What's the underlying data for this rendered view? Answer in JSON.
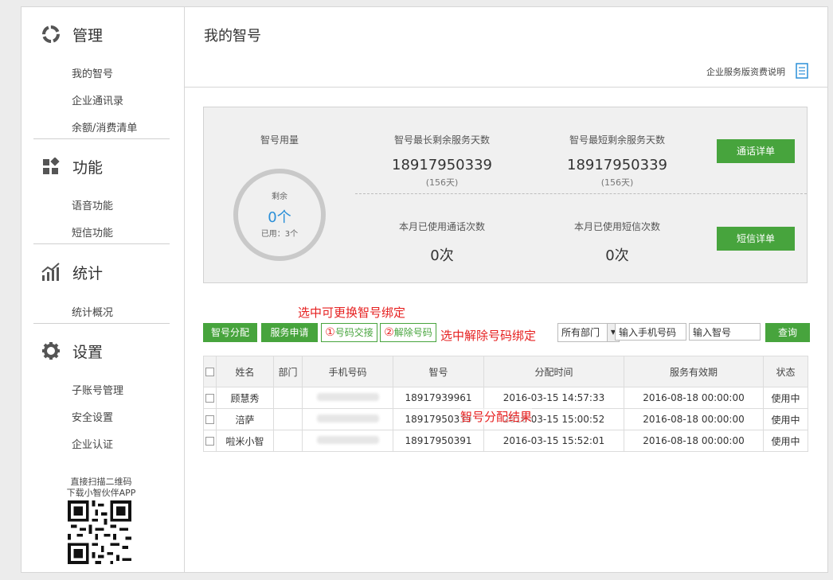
{
  "sidebar": {
    "sections": [
      {
        "title": "管理",
        "icon": "manage-icon",
        "items": [
          "我的智号",
          "企业通讯录",
          "余额/消费清单"
        ]
      },
      {
        "title": "功能",
        "icon": "function-grid-icon",
        "items": [
          "语音功能",
          "短信功能"
        ]
      },
      {
        "title": "统计",
        "icon": "statistics-chart-icon",
        "items": [
          "统计概况"
        ]
      },
      {
        "title": "设置",
        "icon": "settings-gear-icon",
        "items": [
          "子账号管理",
          "安全设置",
          "企业认证"
        ]
      }
    ],
    "qr_caption_1": "直接扫描二维码",
    "qr_caption_2": "下载小智伙伴APP"
  },
  "header": {
    "title": "我的智号",
    "pricing_link": "企业服务版资费说明"
  },
  "stats": {
    "usage_label": "智号用量",
    "remaining_label": "剩余",
    "remaining_value": "0个",
    "used_text": "已用：3个",
    "used_fraction": 1.0,
    "longest_label": "智号最长剩余服务天数",
    "longest_number": "18917950339",
    "longest_days": "(156天)",
    "shortest_label": "智号最短剩余服务天数",
    "shortest_number": "18917950339",
    "shortest_days": "(156天)",
    "calls_label": "本月已使用通话次数",
    "calls_value": "0次",
    "sms_label": "本月已使用短信次数",
    "sms_value": "0次",
    "call_detail_btn": "通话详单",
    "sms_detail_btn": "短信详单"
  },
  "annotations": {
    "swap_note": "选中可更换智号绑定",
    "unbind_note": "选中解除号码绑定",
    "result_note": "智号分配结果",
    "num1": "①",
    "num2": "②"
  },
  "toolbar": {
    "assign": "智号分配",
    "apply": "服务申请",
    "swap": "号码交接",
    "unbind": "解除号码",
    "department": "所有部门",
    "phone_placeholder": "输入手机号码",
    "zhihao_placeholder": "输入智号",
    "query": "查询"
  },
  "table": {
    "headers": [
      "姓名",
      "部门",
      "手机号码",
      "智号",
      "分配时间",
      "服务有效期",
      "状态"
    ],
    "rows": [
      {
        "name": "顾慧秀",
        "dept": "",
        "zhihao": "18917939961",
        "time": "2016-03-15 14:57:33",
        "expiry": "2016-08-18 00:00:00",
        "status": "使用中"
      },
      {
        "name": "涪萨",
        "dept": "",
        "zhihao": "18917950339",
        "time": "2016-03-15 15:00:52",
        "expiry": "2016-08-18 00:00:00",
        "status": "使用中"
      },
      {
        "name": "啦米小智",
        "dept": "",
        "zhihao": "18917950391",
        "time": "2016-03-15 15:52:01",
        "expiry": "2016-08-18 00:00:00",
        "status": "使用中"
      }
    ]
  },
  "colors": {
    "accent": "#47a43d",
    "note_red": "#e62020",
    "ring_blue": "#2a8fd8"
  }
}
